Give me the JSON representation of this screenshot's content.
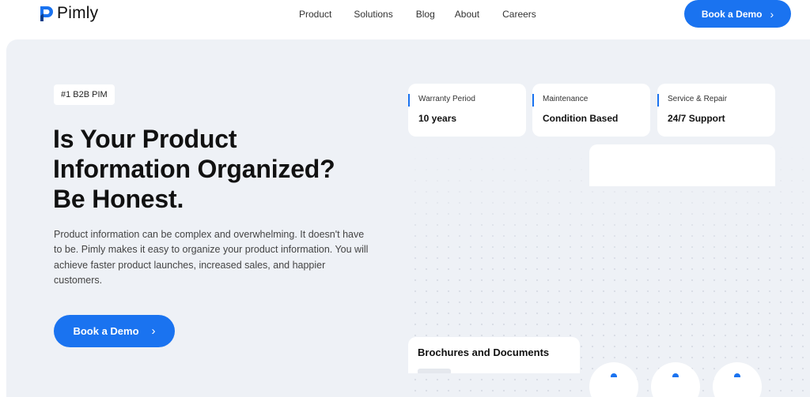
{
  "header": {
    "brand": "Pimly",
    "nav": [
      "Product",
      "Solutions",
      "Blog",
      "About",
      "Careers"
    ],
    "cta_label": "Book a Demo"
  },
  "hero": {
    "badge": "#1 B2B PIM",
    "headline": [
      "Is Your Product",
      "Information Organized?",
      "Be Honest."
    ],
    "paragraph": "Product information can be complex and overwhelming. It doesn't have to be. Pimly makes it easy to organize your product information. You will achieve faster product launches, increased sales, and happier customers.",
    "cta_label": "Book a Demo"
  },
  "specs": [
    {
      "label": "Warranty Period",
      "value": "10 years"
    },
    {
      "label": "Maintenance",
      "value": "Condition Based"
    },
    {
      "label": "Service & Repair",
      "value": "24/7 Support"
    }
  ],
  "docs": {
    "title": "Brochures and Documents"
  },
  "icons": {
    "logo": "pimly-logo-icon",
    "chevron": "chevron-right-icon"
  },
  "colors": {
    "accent": "#1a73f0",
    "hero_bg": "#eef1f6",
    "text": "#111111"
  }
}
